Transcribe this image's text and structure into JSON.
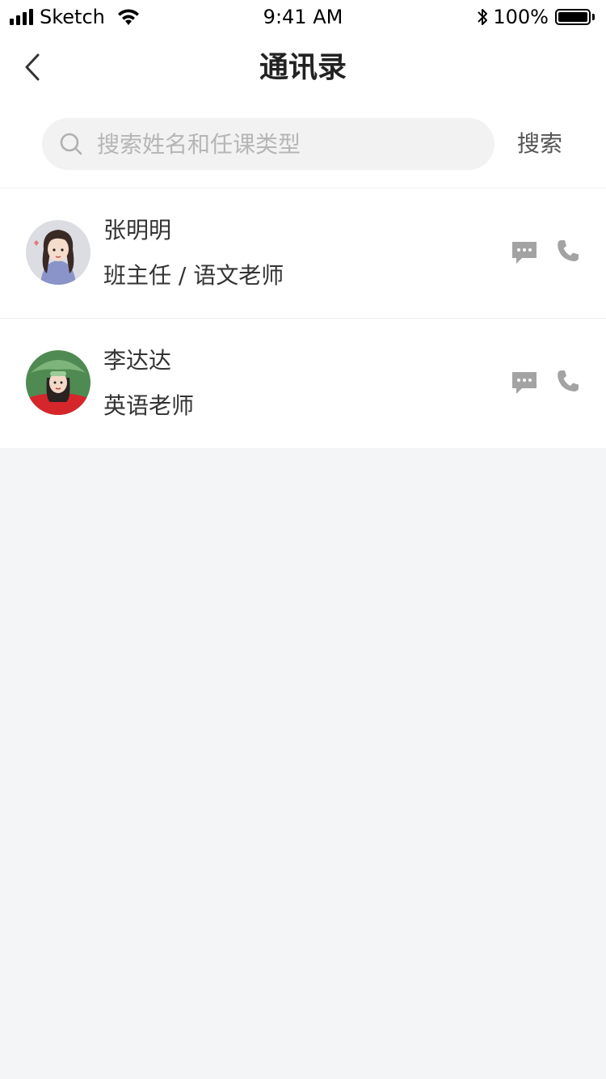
{
  "status_bar": {
    "carrier": "Sketch",
    "time": "9:41 AM",
    "battery_percent": "100%",
    "battery_level": 1.0
  },
  "nav": {
    "title": "通讯录",
    "back_icon": "chevron-left-icon"
  },
  "search": {
    "placeholder": "搜索姓名和任课类型",
    "value": "",
    "button_label": "搜索",
    "icon": "search-icon"
  },
  "contacts": [
    {
      "name": "张明明",
      "role": "班主任 / 语文老师",
      "message_icon": "chat-bubble-icon",
      "call_icon": "phone-icon"
    },
    {
      "name": "李达达",
      "role": "英语老师",
      "message_icon": "chat-bubble-icon",
      "call_icon": "phone-icon"
    }
  ],
  "colors": {
    "page_background": "#f4f5f7",
    "surface": "#ffffff",
    "title_text": "#222222",
    "body_text": "#333333",
    "placeholder": "#b6b6b6",
    "icon_gray": "#9e9e9e",
    "search_field": "#f2f2f2"
  }
}
